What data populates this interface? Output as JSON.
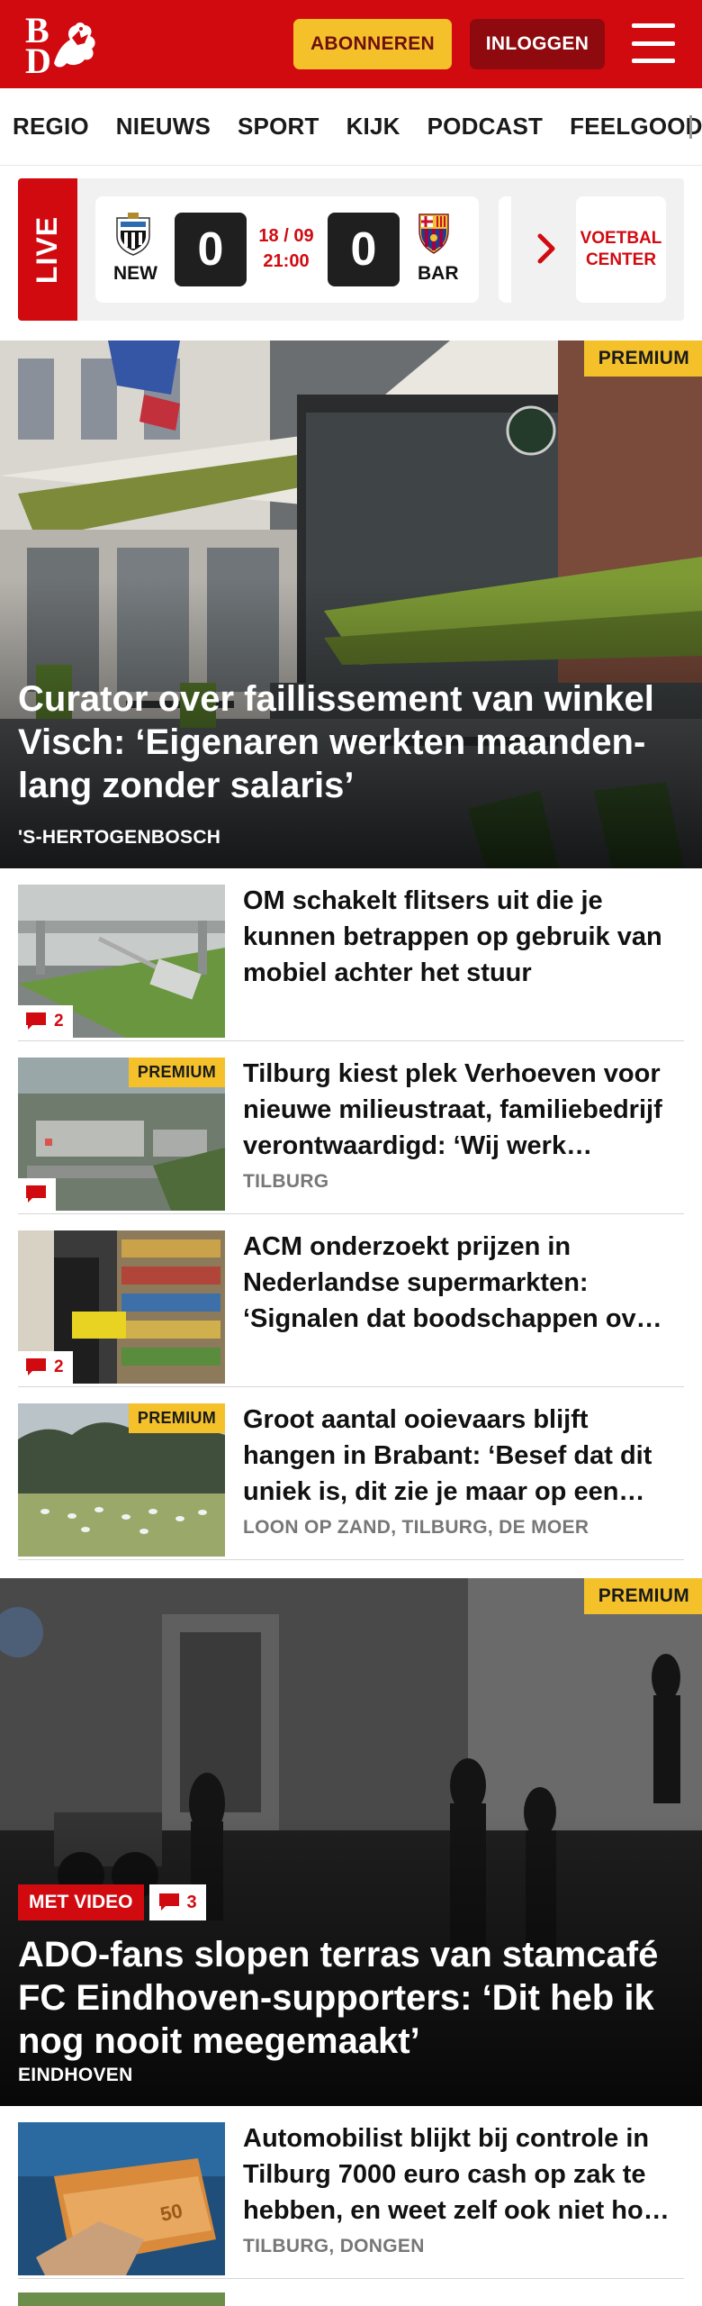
{
  "header": {
    "logo_top": "B",
    "logo_bottom": "D",
    "subscribe_label": "ABONNEREN",
    "login_label": "INLOGGEN"
  },
  "nav": {
    "items": [
      "REGIO",
      "NIEUWS",
      "SPORT",
      "KIJK",
      "PODCAST",
      "FEELGOOD"
    ]
  },
  "live": {
    "tag": "LIVE",
    "home_team": "NEW",
    "away_team": "BAR",
    "home_score": "0",
    "away_score": "0",
    "date": "18 / 09",
    "time": "21:00",
    "center_label": "VOETBAL CENTER"
  },
  "hero1": {
    "premium": "PREMIUM",
    "title": "Curator over faillissement van winkel Visch: ‘Eigenaren werkten maanden­lang zonder salaris’",
    "location": "'S-HERTOGENBOSCH"
  },
  "articles": [
    {
      "title": "OM schakelt flitsers uit die je kunnen betrappen op gebruik van mobiel achter het stuur",
      "comments": "2",
      "premium": "",
      "location": ""
    },
    {
      "title": "Tilburg kiest plek Verhoeven voor nieuwe milieustraat, familiebe­drijf verontwaardigd: ‘Wij werk…",
      "comments": "",
      "premium": "PREMIUM",
      "location": "TILBURG"
    },
    {
      "title": "ACM onderzoekt prijzen in Nederlandse supermarkten: ‘Signalen dat boodschappen ov…",
      "comments": "2",
      "premium": "",
      "location": ""
    },
    {
      "title": "Groot aantal ooievaars blijft hangen in Brabant: ‘Besef dat dit uniek is, dit zie je maar op een…",
      "comments": "",
      "premium": "PREMIUM",
      "location": "LOON OP ZAND, TILBURG, DE MOER"
    }
  ],
  "hero2": {
    "premium": "PREMIUM",
    "video_badge": "MET VIDEO",
    "comments": "3",
    "title": "ADO-fans slopen terras van stamcafé FC Eindhoven-supporters: ‘Dit heb ik nog nooit meegemaakt’",
    "location": "EINDHOVEN"
  },
  "article5": {
    "title": "Automobilist blijkt bij controle in Tilburg 7000 euro cash op zak te hebben, en weet zelf ook niet ho…",
    "location": "TILBURG, DONGEN"
  },
  "colors": {
    "brand_red": "#d10a10",
    "premium_yellow": "#f4c12b",
    "login_dark_red": "#8e0a0f"
  }
}
